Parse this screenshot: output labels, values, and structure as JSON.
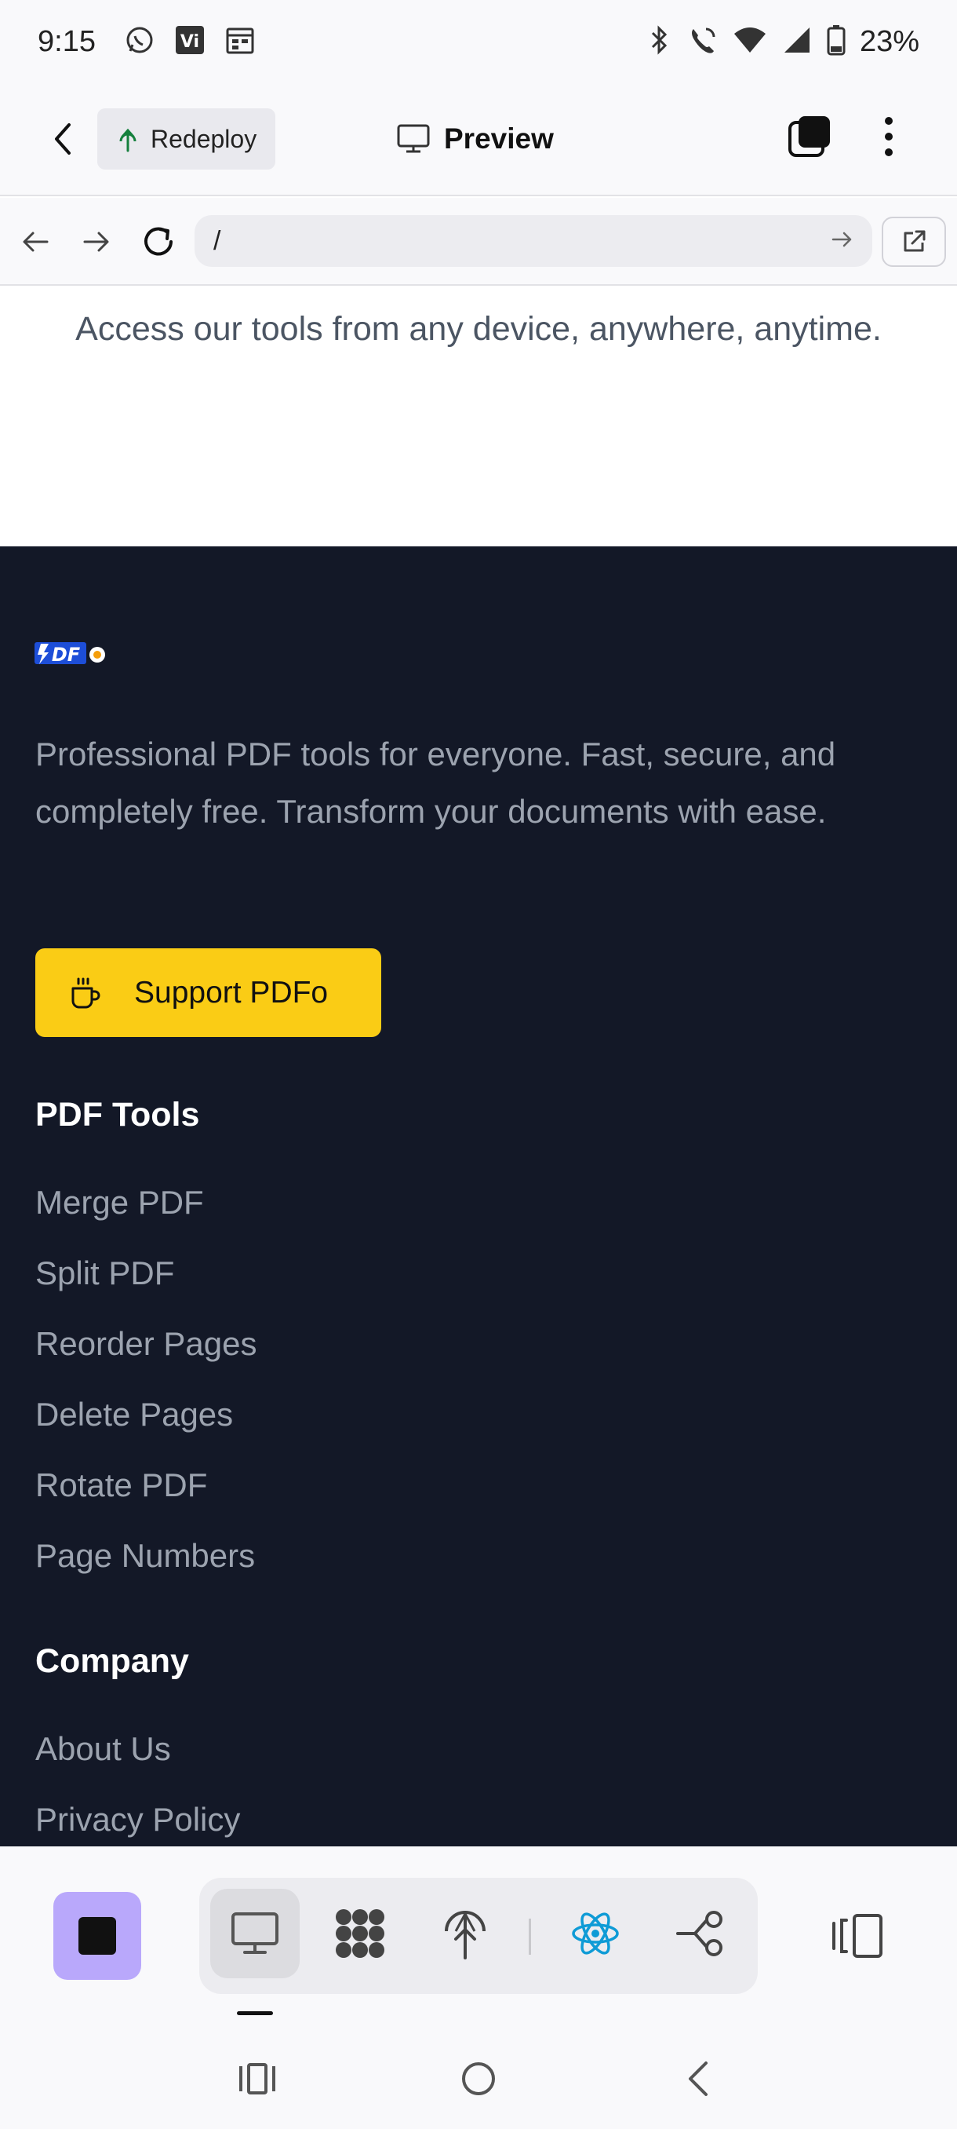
{
  "status_bar": {
    "time": "9:15",
    "battery": "23%",
    "left_icons": [
      "whatsapp-icon",
      "vi-icon",
      "calendar-icon"
    ],
    "right_icons": [
      "bluetooth-icon",
      "wifi-calling-icon",
      "wifi-icon",
      "signal-icon",
      "battery-icon"
    ]
  },
  "header": {
    "redeploy_label": "Redeploy",
    "preview_label": "Preview"
  },
  "url_bar": {
    "url": "/"
  },
  "page": {
    "tagline": "Access our tools from any device, anywhere, anytime.",
    "logo_text": "PDFo",
    "footer_description": "Professional PDF tools for everyone. Fast, secure, and completely free. Transform your documents with ease.",
    "support_label": "Support PDFo",
    "pdf_tools_title": "PDF Tools",
    "pdf_tools": [
      "Merge PDF",
      "Split PDF",
      "Reorder Pages",
      "Delete Pages",
      "Rotate PDF",
      "Page Numbers"
    ],
    "company_title": "Company",
    "company_links": [
      "About Us",
      "Privacy Policy"
    ]
  },
  "colors": {
    "footer_bg": "#131827",
    "support_button": "#facc15",
    "stop_button": "#b9a8fb",
    "react_icon": "#0e9bd6"
  }
}
